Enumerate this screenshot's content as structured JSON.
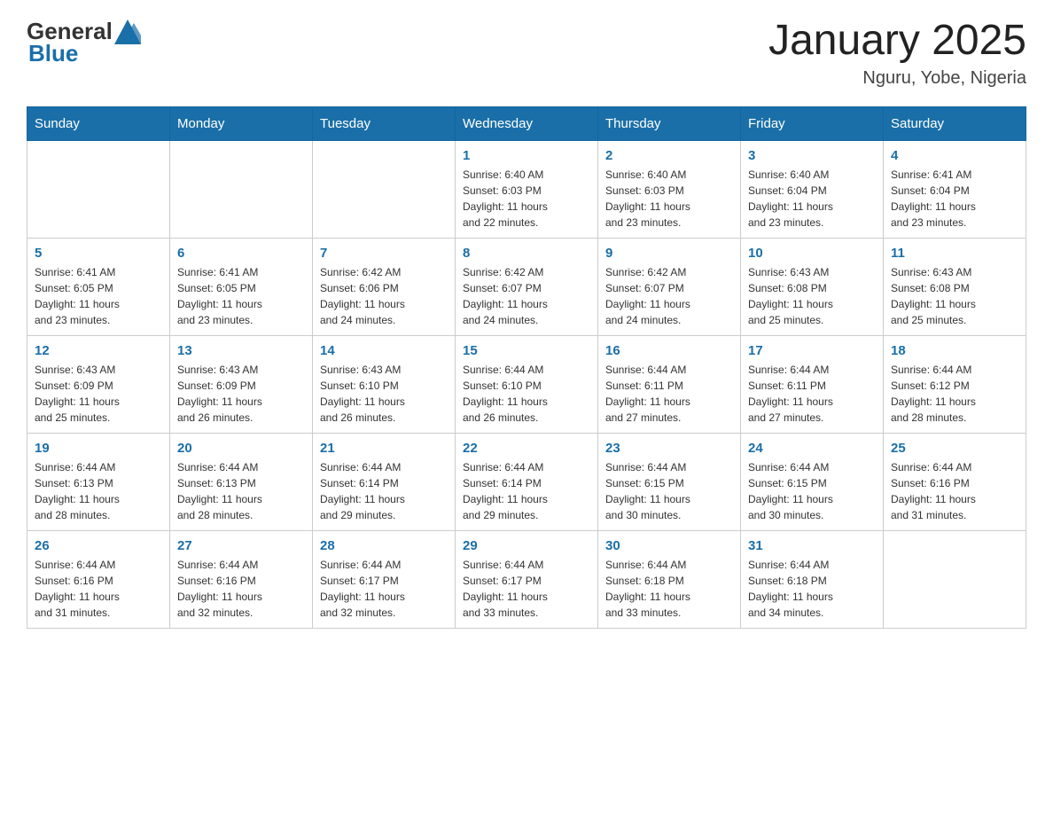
{
  "header": {
    "logo_general": "General",
    "logo_blue": "Blue",
    "title": "January 2025",
    "subtitle": "Nguru, Yobe, Nigeria"
  },
  "weekdays": [
    "Sunday",
    "Monday",
    "Tuesday",
    "Wednesday",
    "Thursday",
    "Friday",
    "Saturday"
  ],
  "weeks": [
    [
      {
        "day": "",
        "info": ""
      },
      {
        "day": "",
        "info": ""
      },
      {
        "day": "",
        "info": ""
      },
      {
        "day": "1",
        "info": "Sunrise: 6:40 AM\nSunset: 6:03 PM\nDaylight: 11 hours\nand 22 minutes."
      },
      {
        "day": "2",
        "info": "Sunrise: 6:40 AM\nSunset: 6:03 PM\nDaylight: 11 hours\nand 23 minutes."
      },
      {
        "day": "3",
        "info": "Sunrise: 6:40 AM\nSunset: 6:04 PM\nDaylight: 11 hours\nand 23 minutes."
      },
      {
        "day": "4",
        "info": "Sunrise: 6:41 AM\nSunset: 6:04 PM\nDaylight: 11 hours\nand 23 minutes."
      }
    ],
    [
      {
        "day": "5",
        "info": "Sunrise: 6:41 AM\nSunset: 6:05 PM\nDaylight: 11 hours\nand 23 minutes."
      },
      {
        "day": "6",
        "info": "Sunrise: 6:41 AM\nSunset: 6:05 PM\nDaylight: 11 hours\nand 23 minutes."
      },
      {
        "day": "7",
        "info": "Sunrise: 6:42 AM\nSunset: 6:06 PM\nDaylight: 11 hours\nand 24 minutes."
      },
      {
        "day": "8",
        "info": "Sunrise: 6:42 AM\nSunset: 6:07 PM\nDaylight: 11 hours\nand 24 minutes."
      },
      {
        "day": "9",
        "info": "Sunrise: 6:42 AM\nSunset: 6:07 PM\nDaylight: 11 hours\nand 24 minutes."
      },
      {
        "day": "10",
        "info": "Sunrise: 6:43 AM\nSunset: 6:08 PM\nDaylight: 11 hours\nand 25 minutes."
      },
      {
        "day": "11",
        "info": "Sunrise: 6:43 AM\nSunset: 6:08 PM\nDaylight: 11 hours\nand 25 minutes."
      }
    ],
    [
      {
        "day": "12",
        "info": "Sunrise: 6:43 AM\nSunset: 6:09 PM\nDaylight: 11 hours\nand 25 minutes."
      },
      {
        "day": "13",
        "info": "Sunrise: 6:43 AM\nSunset: 6:09 PM\nDaylight: 11 hours\nand 26 minutes."
      },
      {
        "day": "14",
        "info": "Sunrise: 6:43 AM\nSunset: 6:10 PM\nDaylight: 11 hours\nand 26 minutes."
      },
      {
        "day": "15",
        "info": "Sunrise: 6:44 AM\nSunset: 6:10 PM\nDaylight: 11 hours\nand 26 minutes."
      },
      {
        "day": "16",
        "info": "Sunrise: 6:44 AM\nSunset: 6:11 PM\nDaylight: 11 hours\nand 27 minutes."
      },
      {
        "day": "17",
        "info": "Sunrise: 6:44 AM\nSunset: 6:11 PM\nDaylight: 11 hours\nand 27 minutes."
      },
      {
        "day": "18",
        "info": "Sunrise: 6:44 AM\nSunset: 6:12 PM\nDaylight: 11 hours\nand 28 minutes."
      }
    ],
    [
      {
        "day": "19",
        "info": "Sunrise: 6:44 AM\nSunset: 6:13 PM\nDaylight: 11 hours\nand 28 minutes."
      },
      {
        "day": "20",
        "info": "Sunrise: 6:44 AM\nSunset: 6:13 PM\nDaylight: 11 hours\nand 28 minutes."
      },
      {
        "day": "21",
        "info": "Sunrise: 6:44 AM\nSunset: 6:14 PM\nDaylight: 11 hours\nand 29 minutes."
      },
      {
        "day": "22",
        "info": "Sunrise: 6:44 AM\nSunset: 6:14 PM\nDaylight: 11 hours\nand 29 minutes."
      },
      {
        "day": "23",
        "info": "Sunrise: 6:44 AM\nSunset: 6:15 PM\nDaylight: 11 hours\nand 30 minutes."
      },
      {
        "day": "24",
        "info": "Sunrise: 6:44 AM\nSunset: 6:15 PM\nDaylight: 11 hours\nand 30 minutes."
      },
      {
        "day": "25",
        "info": "Sunrise: 6:44 AM\nSunset: 6:16 PM\nDaylight: 11 hours\nand 31 minutes."
      }
    ],
    [
      {
        "day": "26",
        "info": "Sunrise: 6:44 AM\nSunset: 6:16 PM\nDaylight: 11 hours\nand 31 minutes."
      },
      {
        "day": "27",
        "info": "Sunrise: 6:44 AM\nSunset: 6:16 PM\nDaylight: 11 hours\nand 32 minutes."
      },
      {
        "day": "28",
        "info": "Sunrise: 6:44 AM\nSunset: 6:17 PM\nDaylight: 11 hours\nand 32 minutes."
      },
      {
        "day": "29",
        "info": "Sunrise: 6:44 AM\nSunset: 6:17 PM\nDaylight: 11 hours\nand 33 minutes."
      },
      {
        "day": "30",
        "info": "Sunrise: 6:44 AM\nSunset: 6:18 PM\nDaylight: 11 hours\nand 33 minutes."
      },
      {
        "day": "31",
        "info": "Sunrise: 6:44 AM\nSunset: 6:18 PM\nDaylight: 11 hours\nand 34 minutes."
      },
      {
        "day": "",
        "info": ""
      }
    ]
  ]
}
